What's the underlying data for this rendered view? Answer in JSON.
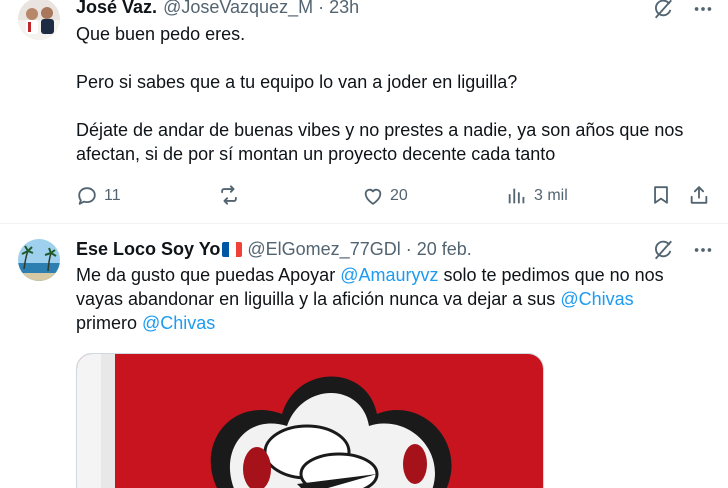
{
  "tweets": [
    {
      "author_name": "José Vaz.",
      "handle": "@JoseVazquez_M",
      "separator": "·",
      "time": "23h",
      "paragraphs": [
        "Que buen pedo eres.",
        "Pero si sabes que a tu equipo lo van a joder en liguilla?",
        "Déjate de andar de buenas vibes y no prestes a nadie, ya son años que nos afectan, si de por sí montan un proyecto decente cada tanto"
      ],
      "actions": {
        "reply_count": "11",
        "repost_count": "",
        "like_count": "20",
        "views_count": "3 mil"
      }
    },
    {
      "author_name": "Ese Loco Soy Yo",
      "flag_colors": [
        "#0055a4",
        "#ffffff",
        "#ef4135"
      ],
      "handle": "@ElGomez_77GDl",
      "separator": "·",
      "time": "20 feb.",
      "text_parts": {
        "t1": "Me da gusto que puedas Apoyar ",
        "m1": "@Amauryvz",
        "t2": " solo te pedimos que no nos vayas abandonar en liguilla y la afición nunca va dejar a sus ",
        "m2": "@Chivas",
        "t3": " primero ",
        "m3": "@Chivas"
      }
    }
  ],
  "colors": {
    "text": "#0f1419",
    "secondary": "#536471",
    "link": "#1d9bf0",
    "divider": "#eff3f4",
    "media_red": "#c8141e"
  },
  "icons": {
    "grok": "grok-icon",
    "more": "more-icon",
    "reply": "reply-icon",
    "repost": "repost-icon",
    "like": "heart-icon",
    "views": "views-icon",
    "bookmark": "bookmark-icon",
    "share": "share-icon"
  }
}
